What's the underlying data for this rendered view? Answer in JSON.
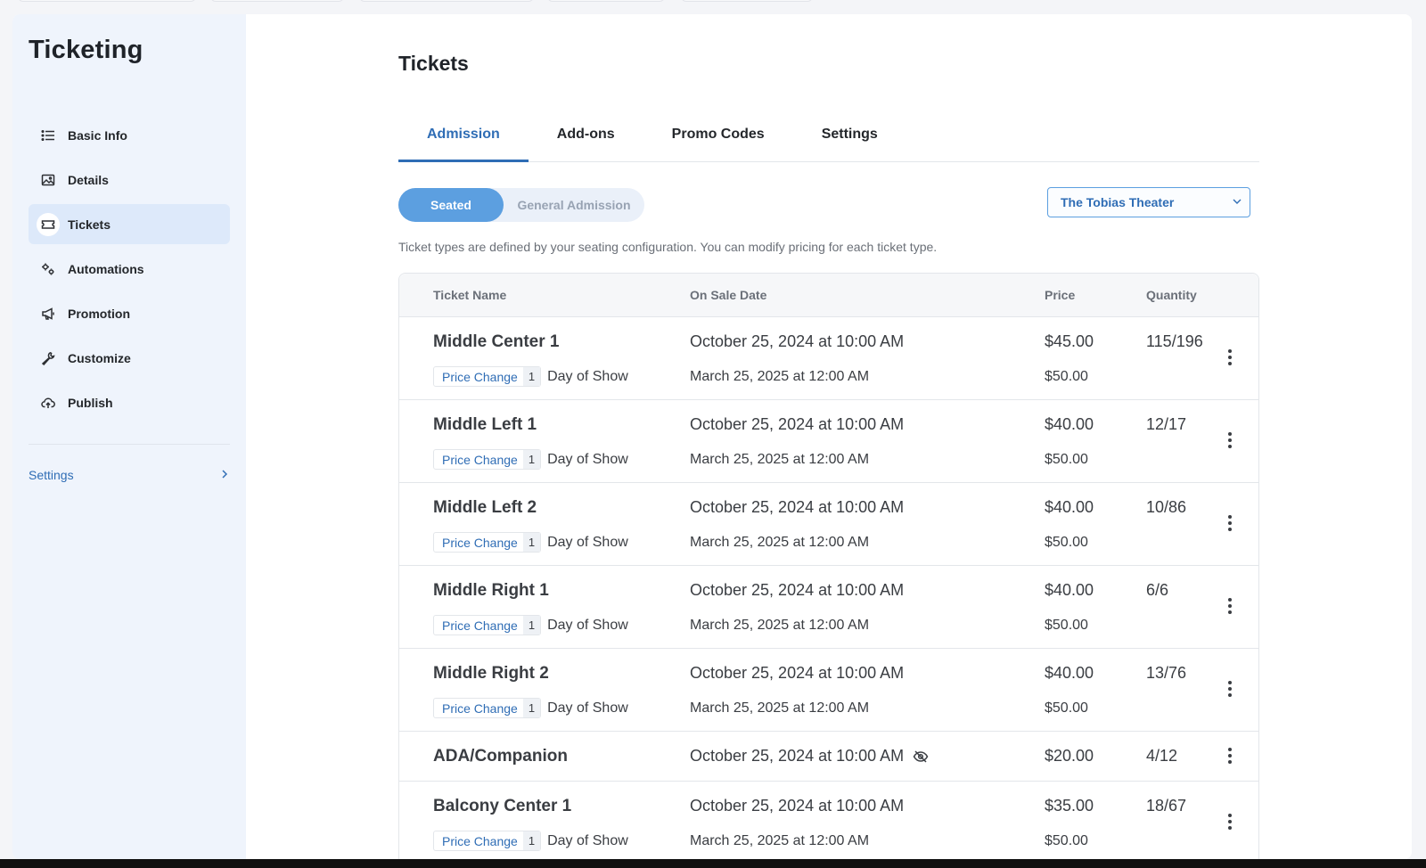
{
  "sidebar": {
    "title": "Ticketing",
    "items": [
      {
        "label": "Basic Info",
        "icon": "list-icon"
      },
      {
        "label": "Details",
        "icon": "image-icon"
      },
      {
        "label": "Tickets",
        "icon": "ticket-icon",
        "active": true
      },
      {
        "label": "Automations",
        "icon": "gears-icon"
      },
      {
        "label": "Promotion",
        "icon": "megaphone-icon"
      },
      {
        "label": "Customize",
        "icon": "wrench-icon"
      },
      {
        "label": "Publish",
        "icon": "cloud-upload-icon"
      }
    ],
    "settings_label": "Settings"
  },
  "main": {
    "title": "Tickets",
    "tabs": [
      {
        "label": "Admission",
        "active": true
      },
      {
        "label": "Add-ons"
      },
      {
        "label": "Promo Codes"
      },
      {
        "label": "Settings"
      }
    ],
    "toggle": {
      "selected": "Seated",
      "other": "General Admission"
    },
    "venue_select": {
      "value": "The Tobias Theater"
    },
    "helper_text": "Ticket types are defined by your seating configuration. You can modify pricing for each ticket type."
  },
  "table": {
    "headers": {
      "name": "Ticket Name",
      "date": "On Sale Date",
      "price": "Price",
      "quantity": "Quantity"
    },
    "rows": [
      {
        "name": "Middle Center 1",
        "on_sale": "October 25, 2024 at 10:00 AM",
        "price": "$45.00",
        "quantity": "115/196",
        "price_change_label": "Price Change",
        "price_change_count": "1",
        "change_desc": "Day of Show",
        "change_date": "March 25, 2025 at 12:00 AM",
        "change_price": "$50.00"
      },
      {
        "name": "Middle Left 1",
        "on_sale": "October 25, 2024 at 10:00 AM",
        "price": "$40.00",
        "quantity": "12/17",
        "price_change_label": "Price Change",
        "price_change_count": "1",
        "change_desc": "Day of Show",
        "change_date": "March 25, 2025 at 12:00 AM",
        "change_price": "$50.00"
      },
      {
        "name": "Middle Left 2",
        "on_sale": "October 25, 2024 at 10:00 AM",
        "price": "$40.00",
        "quantity": "10/86",
        "price_change_label": "Price Change",
        "price_change_count": "1",
        "change_desc": "Day of Show",
        "change_date": "March 25, 2025 at 12:00 AM",
        "change_price": "$50.00"
      },
      {
        "name": "Middle Right 1",
        "on_sale": "October 25, 2024 at 10:00 AM",
        "price": "$40.00",
        "quantity": "6/6",
        "price_change_label": "Price Change",
        "price_change_count": "1",
        "change_desc": "Day of Show",
        "change_date": "March 25, 2025 at 12:00 AM",
        "change_price": "$50.00"
      },
      {
        "name": "Middle Right 2",
        "on_sale": "October 25, 2024 at 10:00 AM",
        "price": "$40.00",
        "quantity": "13/76",
        "price_change_label": "Price Change",
        "price_change_count": "1",
        "change_desc": "Day of Show",
        "change_date": "March 25, 2025 at 12:00 AM",
        "change_price": "$50.00"
      },
      {
        "name": "ADA/Companion",
        "on_sale": "October 25, 2024 at 10:00 AM",
        "price": "$20.00",
        "quantity": "4/12",
        "hidden_icon": "eye-slash-icon"
      },
      {
        "name": "Balcony Center 1",
        "on_sale": "October 25, 2024 at 10:00 AM",
        "price": "$35.00",
        "quantity": "18/67",
        "price_change_label": "Price Change",
        "price_change_count": "1",
        "change_desc": "Day of Show",
        "change_date": "March 25, 2025 at 12:00 AM",
        "change_price": "$50.00"
      }
    ]
  },
  "colors": {
    "accent": "#2f6db5",
    "toggle_active": "#5c9fe0",
    "sidebar_bg": "#eff4fc"
  }
}
